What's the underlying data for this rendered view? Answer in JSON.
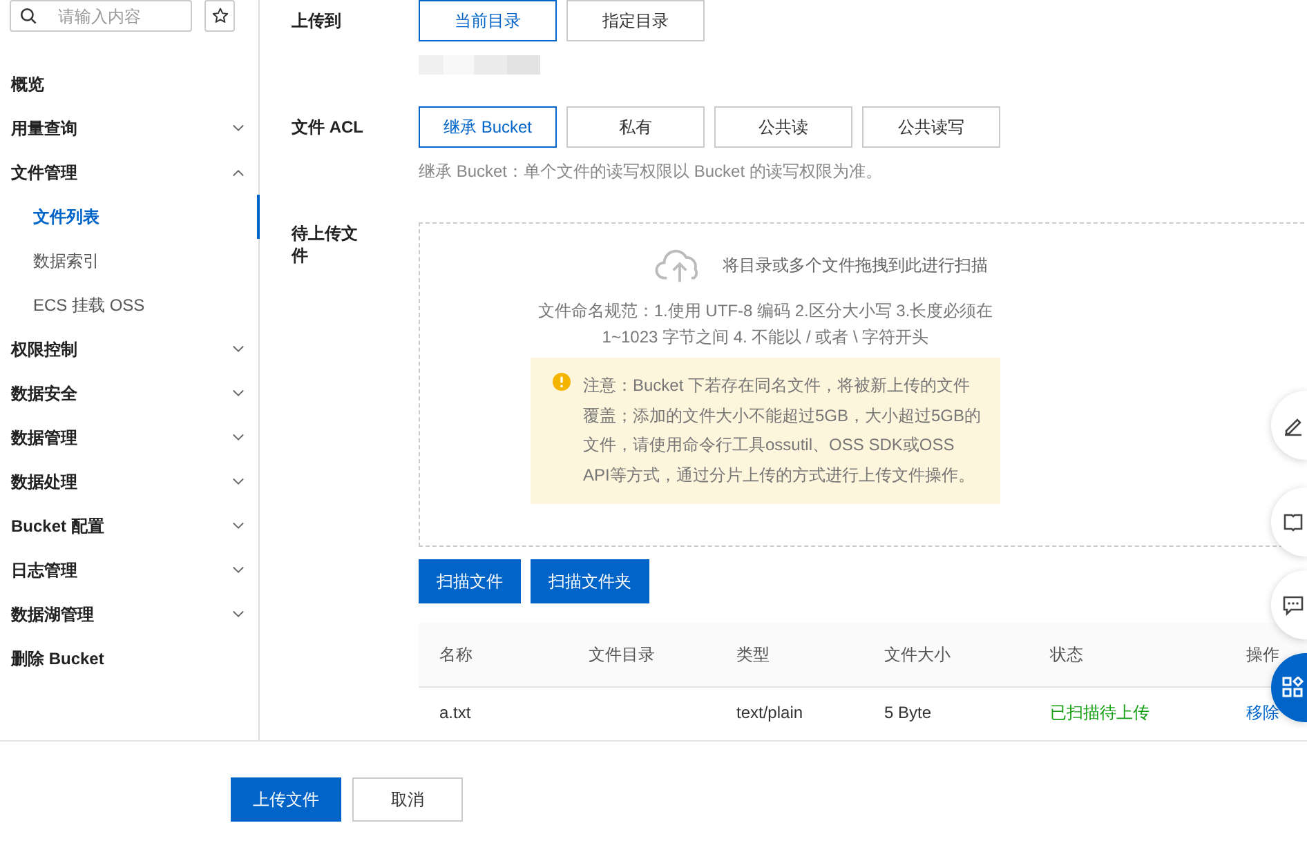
{
  "sidebar": {
    "search": {
      "placeholder": "请输入内容"
    },
    "items": [
      {
        "label": "概览",
        "kind": "link",
        "selected": false
      },
      {
        "label": "用量查询",
        "kind": "group",
        "expanded": false,
        "selected": false
      },
      {
        "label": "文件管理",
        "kind": "group",
        "expanded": true,
        "selected": false,
        "children": [
          {
            "label": "文件列表",
            "selected": true
          },
          {
            "label": "数据索引",
            "selected": false
          },
          {
            "label": "ECS 挂载 OSS",
            "selected": false
          }
        ]
      },
      {
        "label": "权限控制",
        "kind": "group",
        "expanded": false,
        "selected": false
      },
      {
        "label": "数据安全",
        "kind": "group",
        "expanded": false,
        "selected": false
      },
      {
        "label": "数据管理",
        "kind": "group",
        "expanded": false,
        "selected": false
      },
      {
        "label": "数据处理",
        "kind": "group",
        "expanded": false,
        "selected": false
      },
      {
        "label": "Bucket 配置",
        "kind": "group",
        "expanded": false,
        "selected": false
      },
      {
        "label": "日志管理",
        "kind": "group",
        "expanded": false,
        "selected": false
      },
      {
        "label": "数据湖管理",
        "kind": "group",
        "expanded": false,
        "selected": false
      },
      {
        "label": "删除 Bucket",
        "kind": "link",
        "selected": false
      }
    ]
  },
  "upload_to": {
    "label": "上传到",
    "options": [
      {
        "label": "当前目录",
        "selected": true
      },
      {
        "label": "指定目录",
        "selected": false
      }
    ]
  },
  "acl": {
    "label": "文件 ACL",
    "options": [
      {
        "label": "继承 Bucket",
        "selected": true
      },
      {
        "label": "私有",
        "selected": false
      },
      {
        "label": "公共读",
        "selected": false
      },
      {
        "label": "公共读写",
        "selected": false
      }
    ],
    "hint": "继承 Bucket：单个文件的读写权限以 Bucket 的读写权限为准。"
  },
  "pending": {
    "label": "待上传文件",
    "dropzone": {
      "prompt": "将目录或多个文件拖拽到此进行扫描",
      "rules": "文件命名规范：1.使用 UTF-8 编码 2.区分大小写 3.长度必须在 1~1023 字节之间 4. 不能以 / 或者 \\ 字符开头",
      "notice": "注意：Bucket 下若存在同名文件，将被新上传的文件覆盖；添加的文件大小不能超过5GB，大小超过5GB的文件，请使用命令行工具ossutil、OSS SDK或OSS API等方式，通过分片上传的方式进行上传文件操作。"
    },
    "buttons": [
      "扫描文件",
      "扫描文件夹"
    ]
  },
  "table": {
    "columns": [
      "名称",
      "文件目录",
      "类型",
      "文件大小",
      "状态",
      "操作"
    ],
    "rows": [
      {
        "name": "a.txt",
        "type": "text/plain",
        "size": "5 Byte",
        "status": "已扫描待上传",
        "action": "移除"
      }
    ]
  },
  "footer": {
    "buttons": [
      {
        "label": "上传文件",
        "kind": "primary"
      },
      {
        "label": "取消",
        "kind": "default"
      }
    ]
  }
}
